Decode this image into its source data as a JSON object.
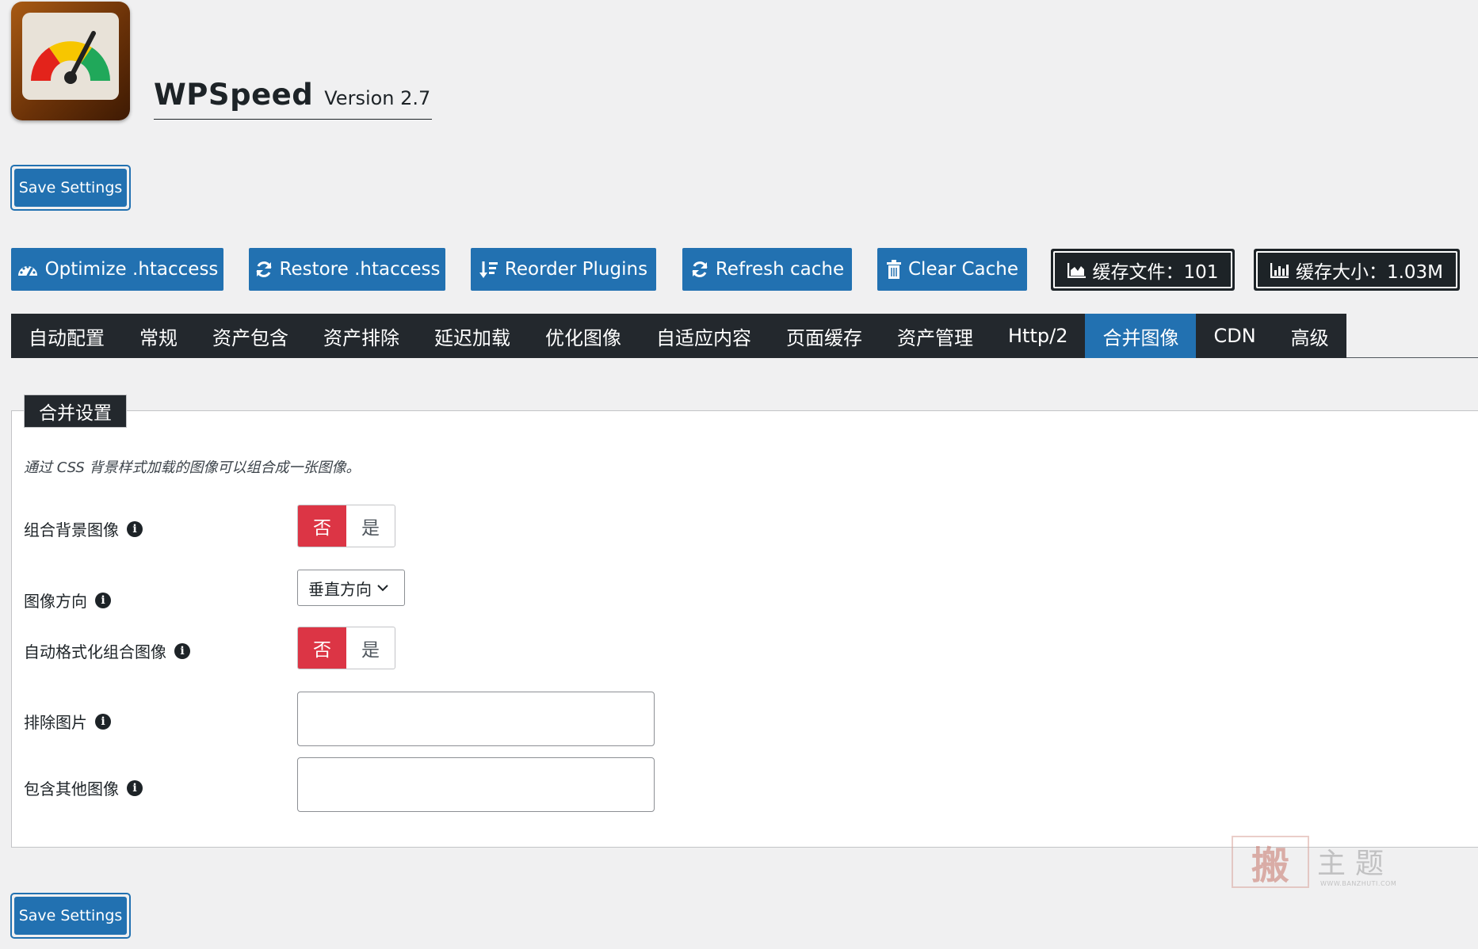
{
  "header": {
    "app_name": "WPSpeed",
    "version": "Version 2.7"
  },
  "save_button_label": "Save Settings",
  "actions": [
    {
      "label": "Optimize .htaccess",
      "icon": "gauge-icon"
    },
    {
      "label": "Restore .htaccess",
      "icon": "refresh-icon"
    },
    {
      "label": "Reorder Plugins",
      "icon": "sort-icon"
    },
    {
      "label": "Refresh cache",
      "icon": "refresh-icon"
    },
    {
      "label": "Clear Cache",
      "icon": "trash-icon"
    }
  ],
  "stats": {
    "cache_files": "缓存文件：101",
    "cache_size": "缓存大小：1.03M"
  },
  "tabs": [
    {
      "label": "自动配置"
    },
    {
      "label": "常规"
    },
    {
      "label": "资产包含"
    },
    {
      "label": "资产排除"
    },
    {
      "label": "延迟加载"
    },
    {
      "label": "优化图像"
    },
    {
      "label": "自适应内容"
    },
    {
      "label": "页面缓存"
    },
    {
      "label": "资产管理"
    },
    {
      "label": "Http/2"
    },
    {
      "label": "合并图像",
      "active": true
    },
    {
      "label": "CDN"
    },
    {
      "label": "高级"
    }
  ],
  "panel": {
    "legend": "合并设置",
    "description": "通过 CSS 背景样式加载的图像可以组合成一张图像。",
    "fields": {
      "combine_bg": {
        "label": "组合背景图像",
        "no": "否",
        "yes": "是",
        "selected": "否"
      },
      "direction": {
        "label": "图像方向",
        "value": "垂直方向"
      },
      "auto_format": {
        "label": "自动格式化组合图像",
        "no": "否",
        "yes": "是",
        "selected": "否"
      },
      "exclude": {
        "label": "排除图片",
        "value": ""
      },
      "include": {
        "label": "包含其他图像",
        "value": ""
      }
    }
  },
  "watermark": {
    "glyph": "搬",
    "text": "主题",
    "url": "WWW.BANZHUTI.COM"
  },
  "colors": {
    "primary": "#2271b1",
    "dark": "#23282d",
    "toggle_on": "#dc3545"
  }
}
